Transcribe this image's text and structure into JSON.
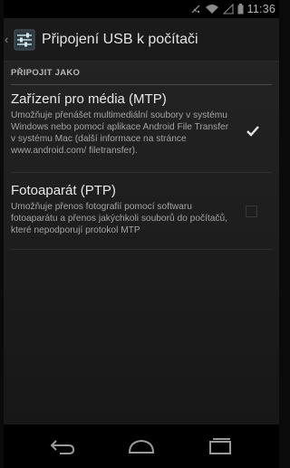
{
  "status_bar": {
    "time": "11:36",
    "icons": [
      "signal-blocked-icon",
      "wifi-icon",
      "cell-signal-icon",
      "battery-icon"
    ]
  },
  "action_bar": {
    "title": "Připojení USB k počítači",
    "up_icon": "chevron-left-icon",
    "app_icon": "settings-app-icon"
  },
  "section": {
    "header": "PŘIPOJIT JAKO"
  },
  "options": [
    {
      "title": "Zařízení pro média (MTP)",
      "summary": "Umožňuje přenášet multimediální soubory v systému Windows nebo pomocí aplikace Android File Transfer v systému Mac (další informace na stránce www.android.com/ filetransfer).",
      "checked": true
    },
    {
      "title": "Fotoaparát (PTP)",
      "summary": "Umožňuje přenos fotografií pomocí softwaru fotoaparátu a přenos jakýchkoli souborů do počítačů, které nepodporují protokol MTP",
      "checked": false
    }
  ],
  "nav_bar": {
    "buttons": [
      "back-icon",
      "home-icon",
      "recent-apps-icon"
    ]
  },
  "colors": {
    "accent": "#e6e6e6",
    "background": "#1d1d1d"
  }
}
